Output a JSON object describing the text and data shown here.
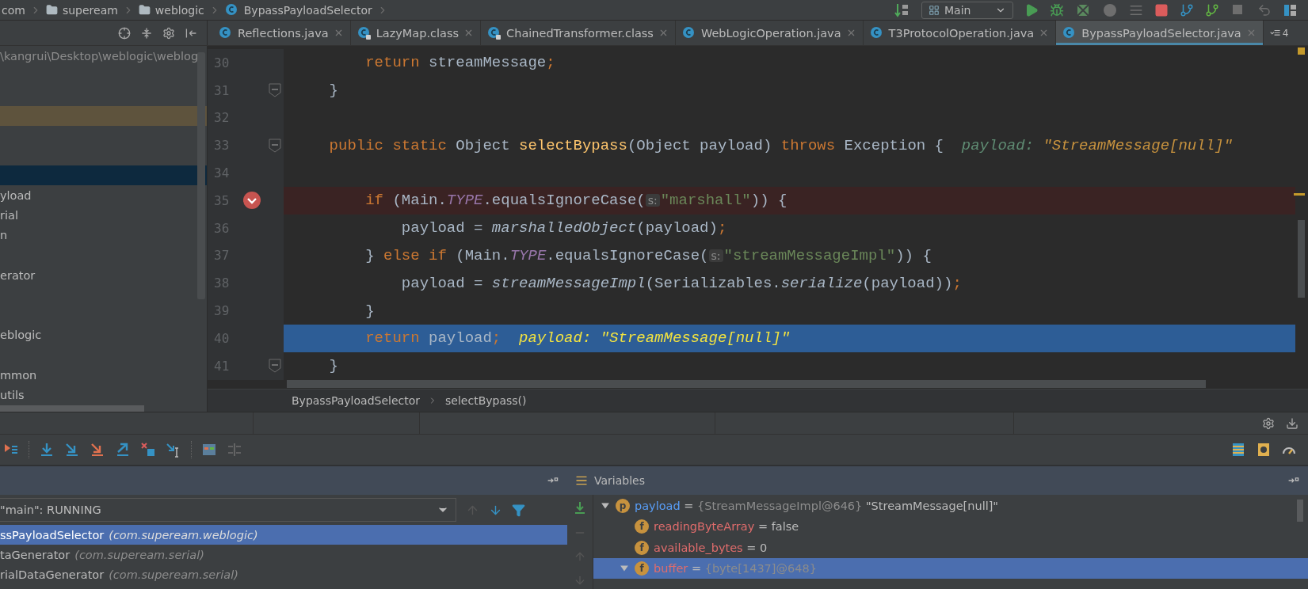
{
  "breadcrumbs": [
    {
      "label": "com",
      "kind": "text"
    },
    {
      "label": "supeream",
      "kind": "folder"
    },
    {
      "label": "weblogic",
      "kind": "folder"
    },
    {
      "label": "BypassPayloadSelector",
      "kind": "class"
    }
  ],
  "run_config": {
    "label": "Main"
  },
  "tabs": [
    {
      "label": "Reflections.java",
      "locked": false,
      "selected": false
    },
    {
      "label": "LazyMap.class",
      "locked": true,
      "selected": false
    },
    {
      "label": "ChainedTransformer.class",
      "locked": true,
      "selected": false
    },
    {
      "label": "WebLogicOperation.java",
      "locked": false,
      "selected": false
    },
    {
      "label": "T3ProtocolOperation.java",
      "locked": false,
      "selected": false
    },
    {
      "label": "BypassPayloadSelector.java",
      "locked": false,
      "selected": true
    }
  ],
  "tab_overflow": {
    "count": "4"
  },
  "project_tree": {
    "rows": [
      {
        "label": "\\kangrui\\Desktop\\weblogic\\weblog",
        "kind": "path",
        "selected": false,
        "highlighted": false
      },
      {
        "selected": false,
        "highlighted": false
      },
      {
        "selected": false,
        "highlighted": false
      },
      {
        "selected": false,
        "highlighted": true
      },
      {
        "selected": false,
        "highlighted": false
      },
      {
        "selected": false,
        "highlighted": false
      },
      {
        "selected": true,
        "highlighted": false
      },
      {
        "label": "yload",
        "kind": "node",
        "selected": false,
        "highlighted": false
      },
      {
        "label": "rial",
        "kind": "node",
        "selected": false,
        "highlighted": false
      },
      {
        "label": "n",
        "kind": "node",
        "selected": false,
        "highlighted": false
      },
      {
        "selected": false,
        "highlighted": false
      },
      {
        "label": "erator",
        "kind": "node",
        "selected": false,
        "highlighted": false
      },
      {
        "selected": false,
        "highlighted": false
      },
      {
        "selected": false,
        "highlighted": false
      },
      {
        "label": "eblogic",
        "kind": "node",
        "selected": false,
        "highlighted": false
      },
      {
        "selected": false,
        "highlighted": false
      },
      {
        "label": "mmon",
        "kind": "node",
        "selected": false,
        "highlighted": false
      },
      {
        "label": "utils",
        "kind": "node",
        "selected": false,
        "highlighted": false
      }
    ]
  },
  "editor": {
    "lines": [
      {
        "number": "30",
        "breakpoint": false,
        "current": false,
        "fold": false,
        "tokens": [
          {
            "text": "        return",
            "kind": "keyword"
          },
          {
            "text": " streamMessage",
            "kind": "plain"
          },
          {
            "text": ";",
            "kind": "keyword"
          }
        ]
      },
      {
        "number": "31",
        "breakpoint": false,
        "current": false,
        "fold": true,
        "tokens": [
          {
            "text": "    }",
            "kind": "plain"
          }
        ]
      },
      {
        "number": "32",
        "breakpoint": false,
        "current": false,
        "fold": false
      },
      {
        "number": "33",
        "breakpoint": false,
        "current": false,
        "fold": true,
        "tokens": [
          {
            "text": "    public static ",
            "kind": "keyword"
          },
          {
            "text": "Object ",
            "kind": "plain"
          },
          {
            "text": "selectBypass",
            "kind": "method"
          },
          {
            "text": "(Object payload) ",
            "kind": "plain"
          },
          {
            "text": "throws ",
            "kind": "keyword"
          },
          {
            "text": "Exception {  ",
            "kind": "plain"
          },
          {
            "text": "payload: ",
            "kind": "debug-name"
          },
          {
            "text": "\"StreamMessage[null]\"",
            "kind": "debug-value"
          }
        ]
      },
      {
        "number": "34",
        "breakpoint": false,
        "current": false,
        "fold": false
      },
      {
        "number": "35",
        "breakpoint": true,
        "current": false,
        "fold": false,
        "tokens": [
          {
            "text": "        if ",
            "kind": "keyword"
          },
          {
            "text": "(Main.",
            "kind": "plain"
          },
          {
            "text": "TYPE",
            "kind": "static"
          },
          {
            "text": ".equalsIgnoreCase(",
            "kind": "plain"
          },
          {
            "text": "s:",
            "kind": "param-hint"
          },
          {
            "text": "\"marshall\"",
            "kind": "string"
          },
          {
            "text": ")) {",
            "kind": "plain"
          }
        ]
      },
      {
        "number": "36",
        "breakpoint": false,
        "current": false,
        "fold": false,
        "tokens": [
          {
            "text": "            payload = ",
            "kind": "plain"
          },
          {
            "text": "marshalledObject",
            "kind": "call"
          },
          {
            "text": "(payload)",
            "kind": "plain"
          },
          {
            "text": ";",
            "kind": "keyword"
          }
        ]
      },
      {
        "number": "37",
        "breakpoint": false,
        "current": false,
        "fold": false,
        "tokens": [
          {
            "text": "        } ",
            "kind": "plain"
          },
          {
            "text": "else if ",
            "kind": "keyword"
          },
          {
            "text": "(Main.",
            "kind": "plain"
          },
          {
            "text": "TYPE",
            "kind": "static"
          },
          {
            "text": ".equalsIgnoreCase(",
            "kind": "plain"
          },
          {
            "text": "s:",
            "kind": "param-hint"
          },
          {
            "text": "\"streamMessageImpl\"",
            "kind": "string"
          },
          {
            "text": ")) {",
            "kind": "plain"
          }
        ]
      },
      {
        "number": "38",
        "breakpoint": false,
        "current": false,
        "fold": false,
        "tokens": [
          {
            "text": "            payload = ",
            "kind": "plain"
          },
          {
            "text": "streamMessageImpl",
            "kind": "call"
          },
          {
            "text": "(Serializables.",
            "kind": "plain"
          },
          {
            "text": "serialize",
            "kind": "call"
          },
          {
            "text": "(payload))",
            "kind": "plain"
          },
          {
            "text": ";",
            "kind": "keyword"
          }
        ]
      },
      {
        "number": "39",
        "breakpoint": false,
        "current": false,
        "fold": false,
        "tokens": [
          {
            "text": "        }",
            "kind": "plain"
          }
        ]
      },
      {
        "number": "40",
        "breakpoint": false,
        "current": true,
        "fold": false,
        "tokens": [
          {
            "text": "        return",
            "kind": "keyword"
          },
          {
            "text": " payload",
            "kind": "plain"
          },
          {
            "text": ";",
            "kind": "keyword"
          },
          {
            "text": "  payload: ",
            "kind": "debug-name"
          },
          {
            "text": "\"StreamMessage[null]\"",
            "kind": "debug-value"
          }
        ]
      },
      {
        "number": "41",
        "breakpoint": false,
        "current": false,
        "fold": true,
        "tokens": [
          {
            "text": "    }",
            "kind": "plain"
          }
        ]
      }
    ],
    "breadcrumb": [
      "BypassPayloadSelector",
      "selectBypass()"
    ]
  },
  "debugger": {
    "thread": "\"main\": RUNNING",
    "frames": [
      {
        "method": "ssPayloadSelector",
        "package": "(com.supeream.weblogic)",
        "selected": true
      },
      {
        "method": "taGenerator",
        "package": "(com.supeream.serial)",
        "selected": false
      },
      {
        "method": "rialDataGenerator",
        "package": "(com.supeream.serial)",
        "selected": false
      }
    ],
    "variables_title": "Variables",
    "variables": [
      {
        "badge": "p",
        "kind": "parameter",
        "name": "payload",
        "operator": "=",
        "type": "{StreamMessageImpl@646}",
        "value": "\"StreamMessage[null]\"",
        "expanded": true,
        "selected": false,
        "children": [
          {
            "badge": "f",
            "kind": "field",
            "name": "readingByteArray",
            "operator": "=",
            "value": "false",
            "selected": false
          },
          {
            "badge": "f",
            "kind": "field",
            "name": "available_bytes",
            "operator": "=",
            "value": "0",
            "selected": false
          },
          {
            "badge": "f",
            "kind": "field",
            "name": "buffer",
            "operator": "=",
            "type": "{byte[1437]@648}",
            "expanded": true,
            "selected": true
          }
        ]
      }
    ]
  }
}
